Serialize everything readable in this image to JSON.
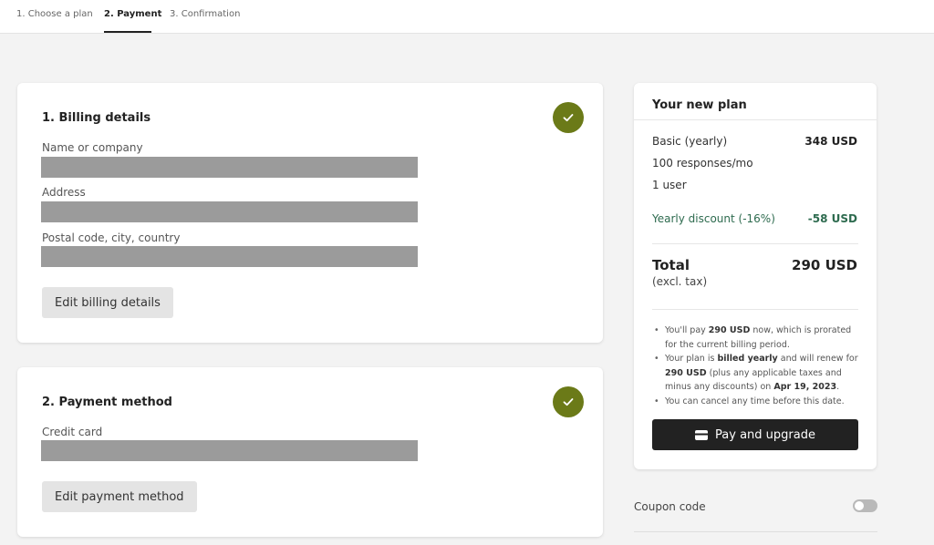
{
  "nav": {
    "steps": [
      "1. Choose a plan",
      "2. Payment",
      "3. Confirmation"
    ],
    "active_step": 1
  },
  "billing": {
    "title": "1. Billing details",
    "fields": [
      "Name or company",
      "Address",
      "Postal code, city, country"
    ],
    "edit_button": "Edit billing details",
    "complete": true
  },
  "payment": {
    "title": "2. Payment method",
    "fields": [
      "Credit card"
    ],
    "edit_button": "Edit payment method",
    "complete": true
  },
  "plan": {
    "title": "Your new plan",
    "plan_name": "Basic (yearly)",
    "plan_price": "348 USD",
    "features": [
      "100 responses/mo",
      "1 user"
    ],
    "discount_label": "Yearly discount (-16%)",
    "discount_value": "-58 USD",
    "total_label": "Total",
    "total_sub": "(excl. tax)",
    "total_value": "290 USD",
    "notes": [
      [
        "You'll pay ",
        "290 USD",
        " now, which is prorated for the current billing period."
      ],
      [
        "Your plan is ",
        "billed yearly",
        " and will renew for ",
        "290 USD",
        " (plus any applicable taxes and minus any discounts) on ",
        "Apr 19, 2023",
        "."
      ],
      [
        "You can cancel any time before this date."
      ]
    ],
    "pay_button": "Pay and upgrade"
  },
  "coupon": {
    "label": "Coupon code",
    "enabled": false
  },
  "colors": {
    "check": "#6b7a18",
    "discount": "#2e6b4f",
    "pay_button": "#222222"
  }
}
